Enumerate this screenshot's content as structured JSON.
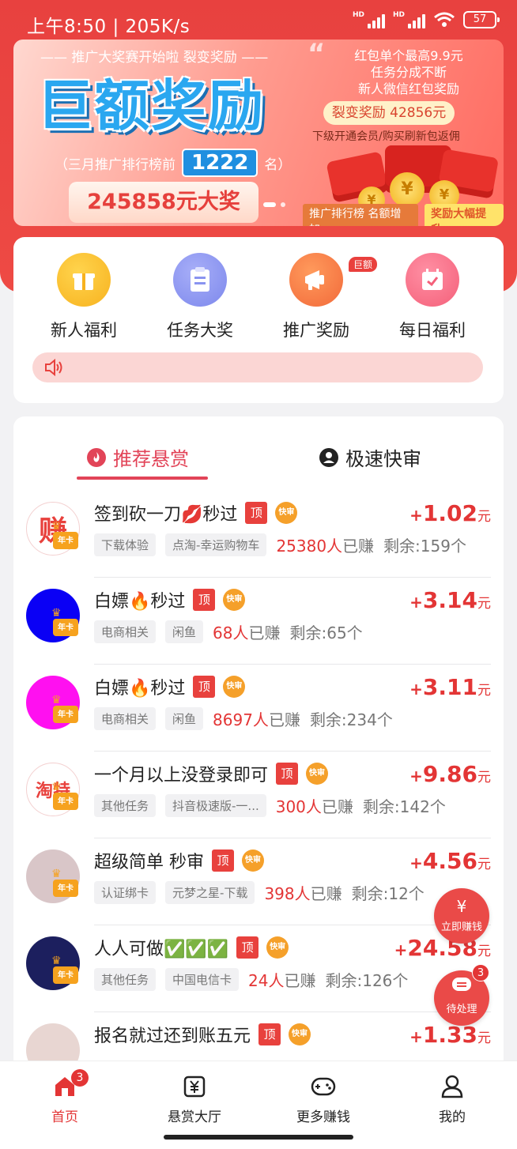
{
  "status_bar": {
    "time": "上午8:50 | 205K/s",
    "battery": "57"
  },
  "banner": {
    "tagline": "—— 推广大奖赛开始啦  裂变奖励 ——",
    "headline": "巨额奖励",
    "rank_prefix": "（三月推广排行榜前",
    "rank_number": "1222",
    "rank_suffix": "名）",
    "prize": "245858元大奖",
    "right_line1": "红包单个最高9.9元",
    "right_line2": "任务分成不断",
    "right_line3": "新人微信红包奖励",
    "split_reward": "裂变奖励 42856元",
    "sub_note": "下级开通会员/购买刷新包返佣",
    "foot_left": "推广排行榜 名额增加",
    "foot_right": "奖励大幅提升"
  },
  "categories": [
    {
      "label": "新人福利",
      "icon": "gift-icon",
      "color": "#f7b21f"
    },
    {
      "label": "任务大奖",
      "icon": "clipboard-icon",
      "color": "#8a94f0"
    },
    {
      "label": "推广奖励",
      "icon": "megaphone-icon",
      "color": "#f26a3a",
      "badge": "巨额"
    },
    {
      "label": "每日福利",
      "icon": "calendar-check-icon",
      "color": "#f4607a"
    }
  ],
  "tabs": {
    "recommended": "推荐悬赏",
    "fast_review": "极速快审"
  },
  "tasks": [
    {
      "title": "签到砍一刀💋秒过",
      "tags": [
        "下载体验",
        "点淘-幸运购物车"
      ],
      "earned_count": "25380人",
      "earned_suffix": "已赚",
      "remaining": "剩余:159个",
      "price_sign": "+",
      "price": "1.02",
      "unit": "元",
      "avatar_text": "赚",
      "avatar_bg": "#ffffff",
      "avatar_fg": "#e8413d",
      "crown": "年卡"
    },
    {
      "title": "白嫖🔥秒过",
      "tags": [
        "电商相关",
        "闲鱼"
      ],
      "earned_count": "68人",
      "earned_suffix": "已赚",
      "remaining": "剩余:65个",
      "price_sign": "+",
      "price": "3.14",
      "unit": "元",
      "avatar_text": "",
      "avatar_bg": "#0a00f5",
      "avatar_fg": "#ffffff",
      "crown": "年卡"
    },
    {
      "title": "白嫖🔥秒过",
      "tags": [
        "电商相关",
        "闲鱼"
      ],
      "earned_count": "8697人",
      "earned_suffix": "已赚",
      "remaining": "剩余:234个",
      "price_sign": "+",
      "price": "3.11",
      "unit": "元",
      "avatar_text": "",
      "avatar_bg": "#ff10f0",
      "avatar_fg": "#ffffff",
      "crown": "年卡"
    },
    {
      "title": "一个月以上没登录即可",
      "tags": [
        "其他任务",
        "抖音极速版-一..."
      ],
      "earned_count": "300人",
      "earned_suffix": "已赚",
      "remaining": "剩余:142个",
      "price_sign": "+",
      "price": "9.86",
      "unit": "元",
      "avatar_text": "淘特",
      "avatar_bg": "#ffffff",
      "avatar_fg": "#e8413d",
      "crown": "年卡"
    },
    {
      "title": "超级简单  秒审",
      "tags": [
        "认证绑卡",
        "元梦之星-下载"
      ],
      "earned_count": "398人",
      "earned_suffix": "已赚",
      "remaining": "剩余:12个",
      "price_sign": "+",
      "price": "4.56",
      "unit": "元",
      "avatar_text": "",
      "avatar_bg": "#d9c6c8",
      "avatar_fg": "#ffffff",
      "crown": "年卡"
    },
    {
      "title": "人人可做✅✅✅",
      "tags": [
        "其他任务",
        "中国电信卡"
      ],
      "earned_count": "24人",
      "earned_suffix": "已赚",
      "remaining": "剩余:126个",
      "price_sign": "+",
      "price": "24.58",
      "unit": "元",
      "avatar_text": "",
      "avatar_bg": "#1c1f5e",
      "avatar_fg": "#ffffff",
      "crown": "年卡"
    },
    {
      "title": "报名就过还到账五元",
      "tags": [],
      "earned_count": "",
      "earned_suffix": "",
      "remaining": "",
      "price_sign": "+",
      "price": "1.33",
      "unit": "元",
      "avatar_text": "",
      "avatar_bg": "#e8d6d2",
      "avatar_fg": "#ffffff",
      "crown": ""
    }
  ],
  "ding_label": "顶",
  "kuai_label": "快审",
  "fabs": {
    "earn_now": "立即赚钱",
    "earn_glyph": "¥",
    "pending": "待处理",
    "pending_count": "3"
  },
  "nav": [
    {
      "label": "首页",
      "icon": "home-icon",
      "badge": "3",
      "active": true
    },
    {
      "label": "悬赏大厅",
      "icon": "reward-hall-icon",
      "active": false
    },
    {
      "label": "更多赚钱",
      "icon": "gamepad-icon",
      "active": false
    },
    {
      "label": "我的",
      "icon": "profile-icon",
      "active": false
    }
  ],
  "colors": {
    "primary_red": "#e8413f",
    "price_red": "#e33535",
    "tab_pink": "#e24458"
  }
}
